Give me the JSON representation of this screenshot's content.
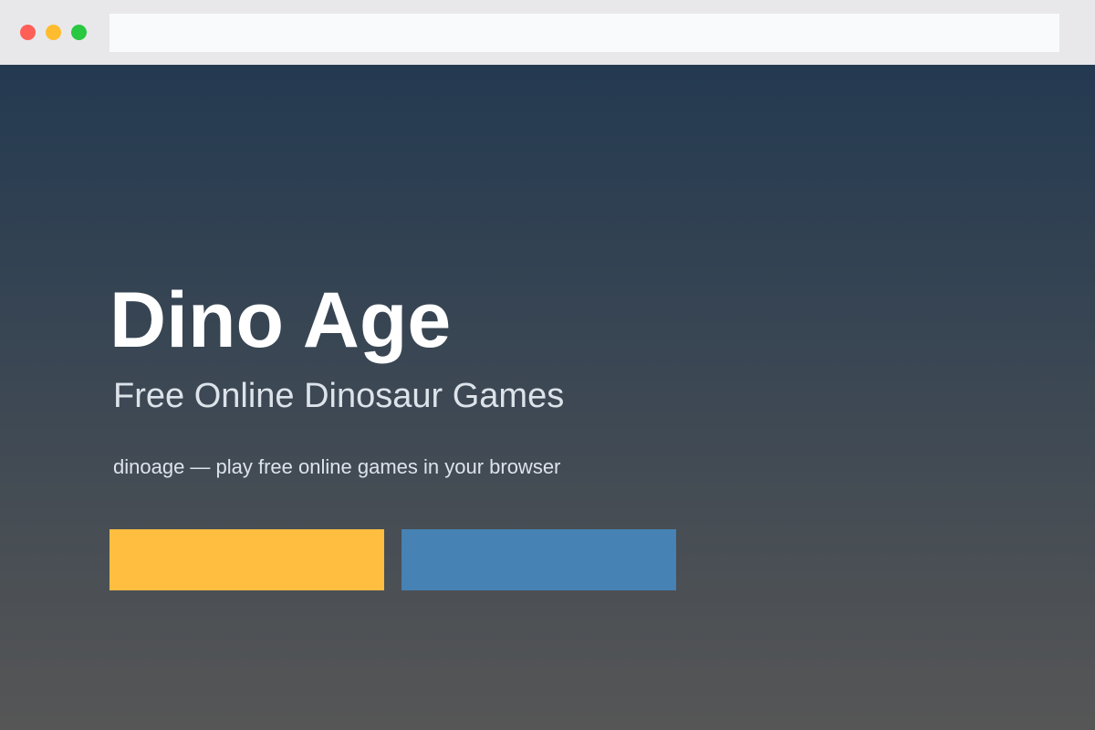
{
  "window": {
    "controls": [
      "close",
      "minimize",
      "maximize"
    ],
    "address_bar": {
      "value": "",
      "placeholder": ""
    }
  },
  "hero": {
    "title": "Dino Age",
    "subtitle": "Free Online Dinosaur Games",
    "tagline": "dinoage — play free online games in your browser",
    "primary_button": {
      "label": ""
    },
    "secondary_button": {
      "label": ""
    }
  },
  "colors": {
    "titlebar": "#e8e8eb",
    "close_dot": "#fe5f57",
    "minimize_dot": "#febc2e",
    "maximize_dot": "#28c840",
    "background_top": "#243a51",
    "background_bottom": "#565656",
    "primary_button": "#ffbe3f",
    "secondary_button": "#4682b4"
  }
}
